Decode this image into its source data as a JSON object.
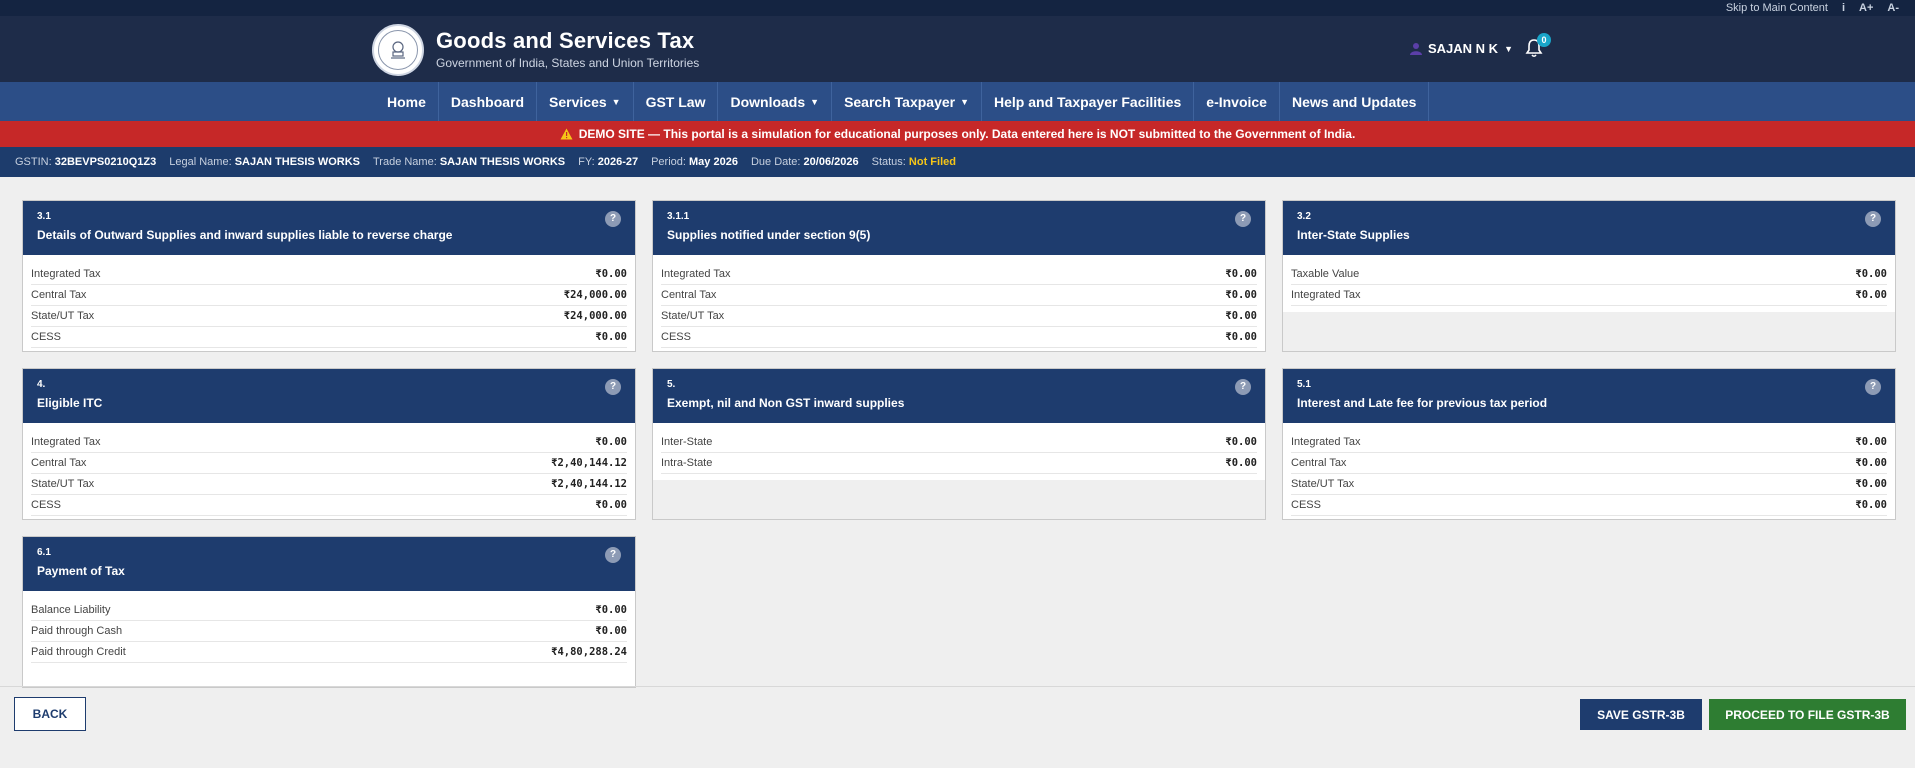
{
  "util": {
    "skip": "Skip to Main Content",
    "info": "i",
    "font_up": "A+",
    "font_down": "A-"
  },
  "header": {
    "title": "Goods and Services Tax",
    "subtitle": "Government of India, States and Union Territories",
    "user": "SAJAN N K",
    "notifications": "0"
  },
  "nav": {
    "home": "Home",
    "dashboard": "Dashboard",
    "services": "Services",
    "gst_law": "GST Law",
    "downloads": "Downloads",
    "search_taxpayer": "Search Taxpayer",
    "help": "Help and Taxpayer Facilities",
    "einvoice": "e-Invoice",
    "news": "News and Updates"
  },
  "demo_banner": "DEMO SITE — This portal is a simulation for educational purposes only. Data entered here is NOT submitted to the Government of India.",
  "info": {
    "gstin_label": "GSTIN:",
    "gstin": "32BEVPS0210Q1Z3",
    "legal_label": "Legal Name:",
    "legal": "SAJAN THESIS WORKS",
    "trade_label": "Trade Name:",
    "trade": "SAJAN THESIS WORKS",
    "fy_label": "FY:",
    "fy": "2026-27",
    "period_label": "Period:",
    "period": "May 2026",
    "due_label": "Due Date:",
    "due": "20/06/2026",
    "status_label": "Status:",
    "status": "Not Filed"
  },
  "cards": [
    {
      "num": "3.1",
      "title": "Details of Outward Supplies and inward supplies liable to reverse charge",
      "rows": [
        {
          "label": "Integrated Tax",
          "value": "₹0.00"
        },
        {
          "label": "Central Tax",
          "value": "₹24,000.00"
        },
        {
          "label": "State/UT Tax",
          "value": "₹24,000.00"
        },
        {
          "label": "CESS",
          "value": "₹0.00"
        }
      ]
    },
    {
      "num": "3.1.1",
      "title": "Supplies notified under section 9(5)",
      "rows": [
        {
          "label": "Integrated Tax",
          "value": "₹0.00"
        },
        {
          "label": "Central Tax",
          "value": "₹0.00"
        },
        {
          "label": "State/UT Tax",
          "value": "₹0.00"
        },
        {
          "label": "CESS",
          "value": "₹0.00"
        }
      ]
    },
    {
      "num": "3.2",
      "title": "Inter-State Supplies",
      "rows": [
        {
          "label": "Taxable Value",
          "value": "₹0.00"
        },
        {
          "label": "Integrated Tax",
          "value": "₹0.00"
        }
      ]
    },
    {
      "num": "4.",
      "title": "Eligible ITC",
      "rows": [
        {
          "label": "Integrated Tax",
          "value": "₹0.00"
        },
        {
          "label": "Central Tax",
          "value": "₹2,40,144.12"
        },
        {
          "label": "State/UT Tax",
          "value": "₹2,40,144.12"
        },
        {
          "label": "CESS",
          "value": "₹0.00"
        }
      ]
    },
    {
      "num": "5.",
      "title": "Exempt, nil and Non GST inward supplies",
      "rows": [
        {
          "label": "Inter-State",
          "value": "₹0.00"
        },
        {
          "label": "Intra-State",
          "value": "₹0.00"
        }
      ]
    },
    {
      "num": "5.1",
      "title": "Interest and Late fee for previous tax period",
      "rows": [
        {
          "label": "Integrated Tax",
          "value": "₹0.00"
        },
        {
          "label": "Central Tax",
          "value": "₹0.00"
        },
        {
          "label": "State/UT Tax",
          "value": "₹0.00"
        },
        {
          "label": "CESS",
          "value": "₹0.00"
        }
      ]
    },
    {
      "num": "6.1",
      "title": "Payment of Tax",
      "rows": [
        {
          "label": "Balance Liability",
          "value": "₹0.00"
        },
        {
          "label": "Paid through Cash",
          "value": "₹0.00"
        },
        {
          "label": "Paid through Credit",
          "value": "₹4,80,288.24"
        }
      ]
    }
  ],
  "help_glyph": "?",
  "buttons": {
    "back": "BACK",
    "save": "SAVE GSTR-3B",
    "proceed": "PROCEED TO FILE GSTR-3B"
  },
  "colors": {
    "header": "#1e2c49",
    "nav": "#2c4e87",
    "demo": "#c62828",
    "card_head": "#1e3c6e",
    "proceed": "#2e7d32",
    "status": "#f5c518"
  }
}
